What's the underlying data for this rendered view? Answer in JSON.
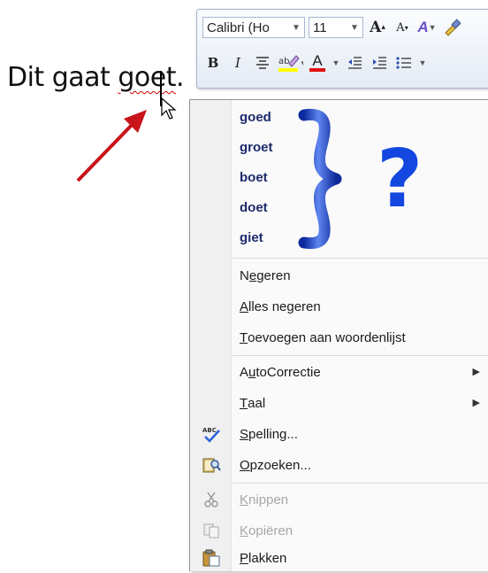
{
  "document": {
    "text_before": "Dit gaat ",
    "misspelled_word": "goet",
    "text_after": "."
  },
  "mini_toolbar": {
    "font_name": "Calibri (Ho",
    "font_size": "11",
    "grow_font_label": "A",
    "shrink_font_label": "A",
    "styles_label": "A",
    "bold_label": "B",
    "italic_label": "I",
    "font_color_label": "A"
  },
  "menu": {
    "suggestions": [
      "goed",
      "groet",
      "boet",
      "doet",
      "giet"
    ],
    "annotation_question": "?",
    "items": {
      "ignore": {
        "pre": "N",
        "u": "e",
        "post": "geren"
      },
      "ignore_all": {
        "pre": "",
        "u": "A",
        "post": "lles negeren"
      },
      "add_dictionary": {
        "pre": "",
        "u": "T",
        "post": "oevoegen aan woordenlijst"
      },
      "autocorrect": {
        "pre": "A",
        "u": "u",
        "post": "toCorrectie"
      },
      "language": {
        "pre": "",
        "u": "T",
        "post": "aal"
      },
      "spelling": {
        "pre": "",
        "u": "S",
        "post": "pelling..."
      },
      "lookup": {
        "pre": "",
        "u": "O",
        "post": "pzoeken..."
      },
      "cut": {
        "pre": "",
        "u": "K",
        "post": "nippen"
      },
      "copy": {
        "pre": "",
        "u": "K",
        "post": "opiëren"
      },
      "paste": {
        "pre": "",
        "u": "P",
        "post": "lakken"
      }
    }
  },
  "colors": {
    "arrow": "#c8141a",
    "brace": "#1f3fd0",
    "question": "#1347e0",
    "highlight_yellow": "#ffff00",
    "font_color_red": "#e01010"
  }
}
